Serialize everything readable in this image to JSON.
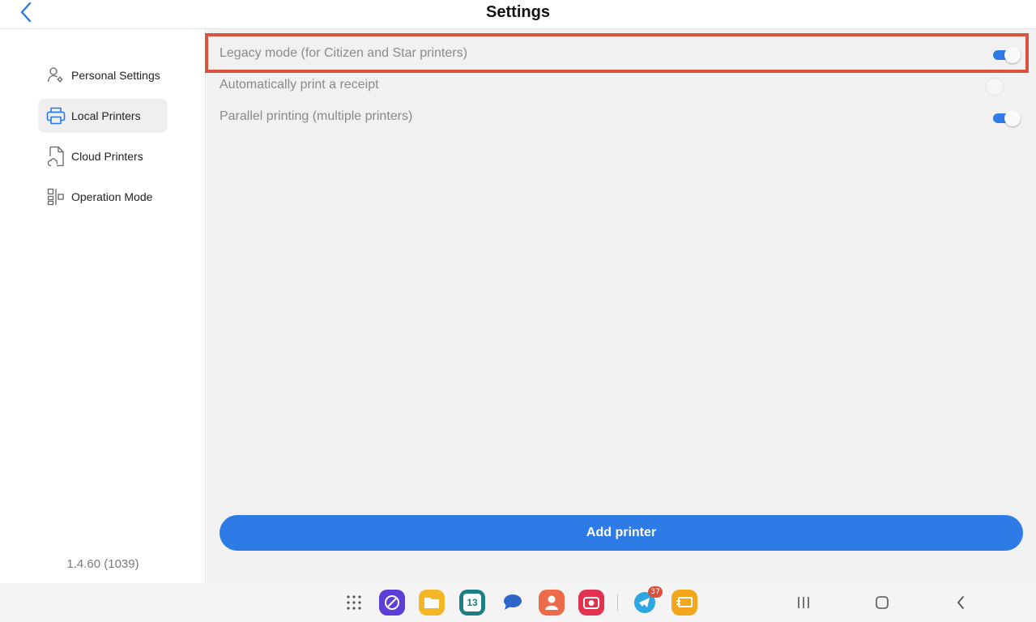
{
  "header": {
    "title": "Settings",
    "back_icon": "chevron-left-icon"
  },
  "sidebar": {
    "items": [
      {
        "label": "Personal Settings",
        "icon": "user-settings-icon",
        "active": false
      },
      {
        "label": "Local Printers",
        "icon": "printer-icon",
        "active": true
      },
      {
        "label": "Cloud Printers",
        "icon": "cloud-document-icon",
        "active": false
      },
      {
        "label": "Operation Mode",
        "icon": "layout-toggle-icon",
        "active": false
      }
    ],
    "version": "1.4.60 (1039)"
  },
  "settings": [
    {
      "label": "Legacy mode (for Citizen and Star printers)",
      "enabled": true,
      "highlighted": true
    },
    {
      "label": "Automatically print a receipt",
      "enabled": false,
      "highlighted": false
    },
    {
      "label": "Parallel printing (multiple printers)",
      "enabled": true,
      "highlighted": false
    }
  ],
  "actions": {
    "add_printer_label": "Add printer"
  },
  "colors": {
    "accent": "#2d7be6",
    "highlight_border": "#d9533f",
    "content_bg": "#f1f1f1"
  },
  "taskbar": {
    "apps": [
      {
        "name": "app-drawer-icon"
      },
      {
        "name": "internet-browser-icon",
        "color": "#5b3fd6"
      },
      {
        "name": "files-icon",
        "color": "#f5b626"
      },
      {
        "name": "calendar-icon",
        "color": "#1d7f86",
        "text": "13"
      },
      {
        "name": "messages-icon",
        "color": "#2d66c8"
      },
      {
        "name": "contacts-icon",
        "color": "#ee6b4a"
      },
      {
        "name": "camera-icon",
        "color": "#e3324f"
      },
      {
        "name": "telegram-icon",
        "color": "#2ea6df",
        "badge": "37"
      },
      {
        "name": "pos-app-icon",
        "color": "#f3a51c"
      }
    ],
    "system": [
      "recents-icon",
      "home-icon",
      "back-icon"
    ]
  }
}
